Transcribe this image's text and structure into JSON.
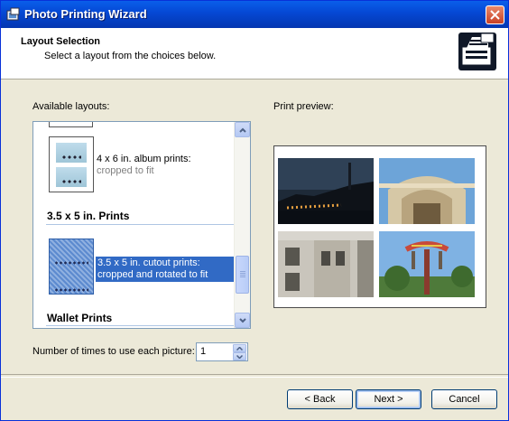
{
  "window": {
    "title": "Photo Printing Wizard",
    "close_icon": "close-icon",
    "app_icon": "photo-wizard-icon"
  },
  "header": {
    "title": "Layout Selection",
    "subtitle": "Select a layout from the choices below.",
    "icon": "printer-wizard-icon"
  },
  "layouts": {
    "label": "Available layouts:",
    "groups": [
      {
        "heading": "",
        "items": [
          {
            "line1": "4 x 6 in. album prints:",
            "line2": "cropped to fit",
            "selected": false
          }
        ]
      },
      {
        "heading": "3.5 x 5 in. Prints",
        "items": [
          {
            "line1": "3.5 x 5 in. cutout prints:",
            "line2": "cropped and rotated to fit",
            "selected": true
          }
        ]
      },
      {
        "heading": "Wallet Prints",
        "items": []
      }
    ]
  },
  "preview": {
    "label": "Print preview:",
    "photos": [
      "night-waterfront-photo",
      "building-facade-photo",
      "stone-building-photo",
      "amusement-ride-photo"
    ]
  },
  "copies": {
    "label": "Number of times to use each picture:",
    "value": "1"
  },
  "buttons": {
    "back": "< Back",
    "next": "Next >",
    "cancel": "Cancel"
  },
  "colors": {
    "titlebar": "#0549D6",
    "selection": "#316AC5",
    "close": "#C94024",
    "dialog_bg": "#ECE9D8"
  }
}
